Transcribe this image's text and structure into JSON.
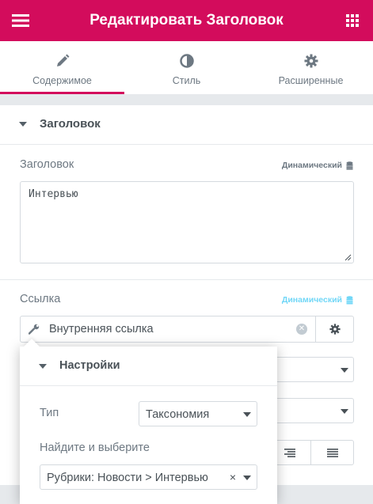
{
  "header": {
    "title": "Редактировать Заголовок",
    "menu_icon": "hamburger-icon",
    "apps_icon": "grid-icon",
    "color": "#d30c5c"
  },
  "tabs": [
    {
      "label": "Содержимое",
      "icon": "pencil-icon",
      "active": true
    },
    {
      "label": "Стиль",
      "icon": "half-circle-icon",
      "active": false
    },
    {
      "label": "Расширенные",
      "icon": "gear-icon",
      "active": false
    }
  ],
  "section": {
    "title": "Заголовок"
  },
  "title_control": {
    "label": "Заголовок",
    "dynamic_label": "Динамический",
    "value": "Интервью"
  },
  "link_control": {
    "label": "Ссылка",
    "dynamic_label": "Динамический",
    "value": "Внутренняя ссылка"
  },
  "popover": {
    "title": "Настройки",
    "type_label": "Тип",
    "type_value": "Таксономия",
    "search_label": "Найдите и выберите",
    "search_value": "Рубрики: Новости > Интервью",
    "clear_symbol": "×"
  }
}
